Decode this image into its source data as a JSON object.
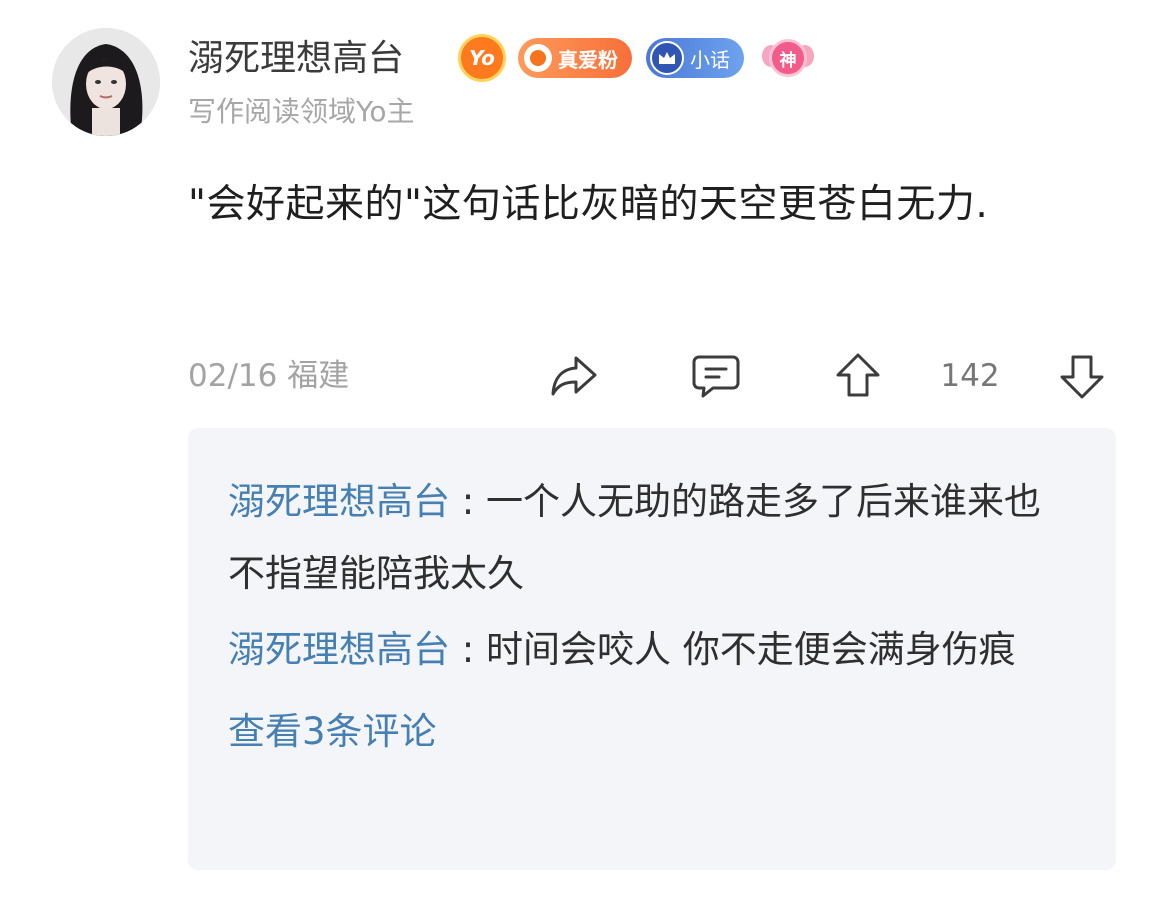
{
  "author": {
    "name": "溺死理想高台",
    "subtitle": "写作阅读领域Yo主",
    "badges": {
      "yo": "Yo",
      "fan": "真爱粉",
      "xiaohua": "小话",
      "shen": "神"
    }
  },
  "post": {
    "text": "\"会好起来的\"这句话比灰暗的天空更苍白无力.",
    "meta": "02/16 福建",
    "upvote_count": "142"
  },
  "comments": [
    {
      "user": "溺死理想高台",
      "separator": " : ",
      "text": "一个人无助的路走多了后来谁来也不指望能陪我太久"
    },
    {
      "user": "溺死理想高台",
      "separator": " : ",
      "text": "时间会咬人  你不走便会满身伤痕"
    }
  ],
  "view_all": "查看3条评论",
  "icons": {
    "share": "share-icon",
    "comment": "comment-icon",
    "upvote": "upvote-icon",
    "downvote": "downvote-icon"
  },
  "colors": {
    "link_blue": "#4680b2",
    "comment_bg": "#f4f5f8",
    "muted_text": "#a3a3a3"
  }
}
